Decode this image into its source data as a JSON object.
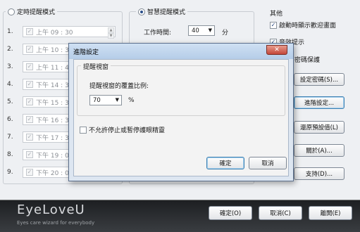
{
  "left_panel": {
    "mode_label": "定時提醒模式",
    "rows": [
      {
        "num": "1.",
        "time": "上午 09 : 30"
      },
      {
        "num": "2.",
        "time": "上午 10 : 30"
      },
      {
        "num": "3.",
        "time": "上午 11 : 45"
      },
      {
        "num": "4.",
        "time": "下午 14 : 30"
      },
      {
        "num": "5.",
        "time": "下午 15 : 30"
      },
      {
        "num": "6.",
        "time": "下午 16 : 30"
      },
      {
        "num": "7.",
        "time": "下午 17 : 30"
      },
      {
        "num": "8.",
        "time": "下午 19 : 00"
      },
      {
        "num": "9.",
        "time": "下午 20 : 00"
      }
    ]
  },
  "middle_panel": {
    "mode_label": "智慧提醒模式",
    "work_time_label": "工作時間:",
    "work_time_value": "40",
    "work_time_unit": "分"
  },
  "right_panel": {
    "title": "其他",
    "show_welcome_label": "啟動時顯示歡迎畫面",
    "sound_label": "音效提示",
    "password_label": "密碼保護",
    "set_password_button": "設定密碼(S)...",
    "advanced_button": "進階設定...",
    "restore_defaults_button": "還原預設值(L)",
    "about_button": "關於(A)...",
    "support_button": "支持(D)..."
  },
  "footer": {
    "logo": "EyeLoveU",
    "slogan": "Eyes care wizard for everybody",
    "ok_button": "確定(O)",
    "cancel_button": "取消(C)",
    "exit_button": "離開(E)"
  },
  "dialog": {
    "title": "進階設定",
    "close_glyph": "✕",
    "group_title": "提醒視窗",
    "coverage_label": "提醒視窗的覆蓋比例:",
    "coverage_value": "70",
    "coverage_unit": "%",
    "no_stop_label": "不允許停止或暫停護眼精靈",
    "ok_button": "確定",
    "cancel_button": "取消"
  }
}
